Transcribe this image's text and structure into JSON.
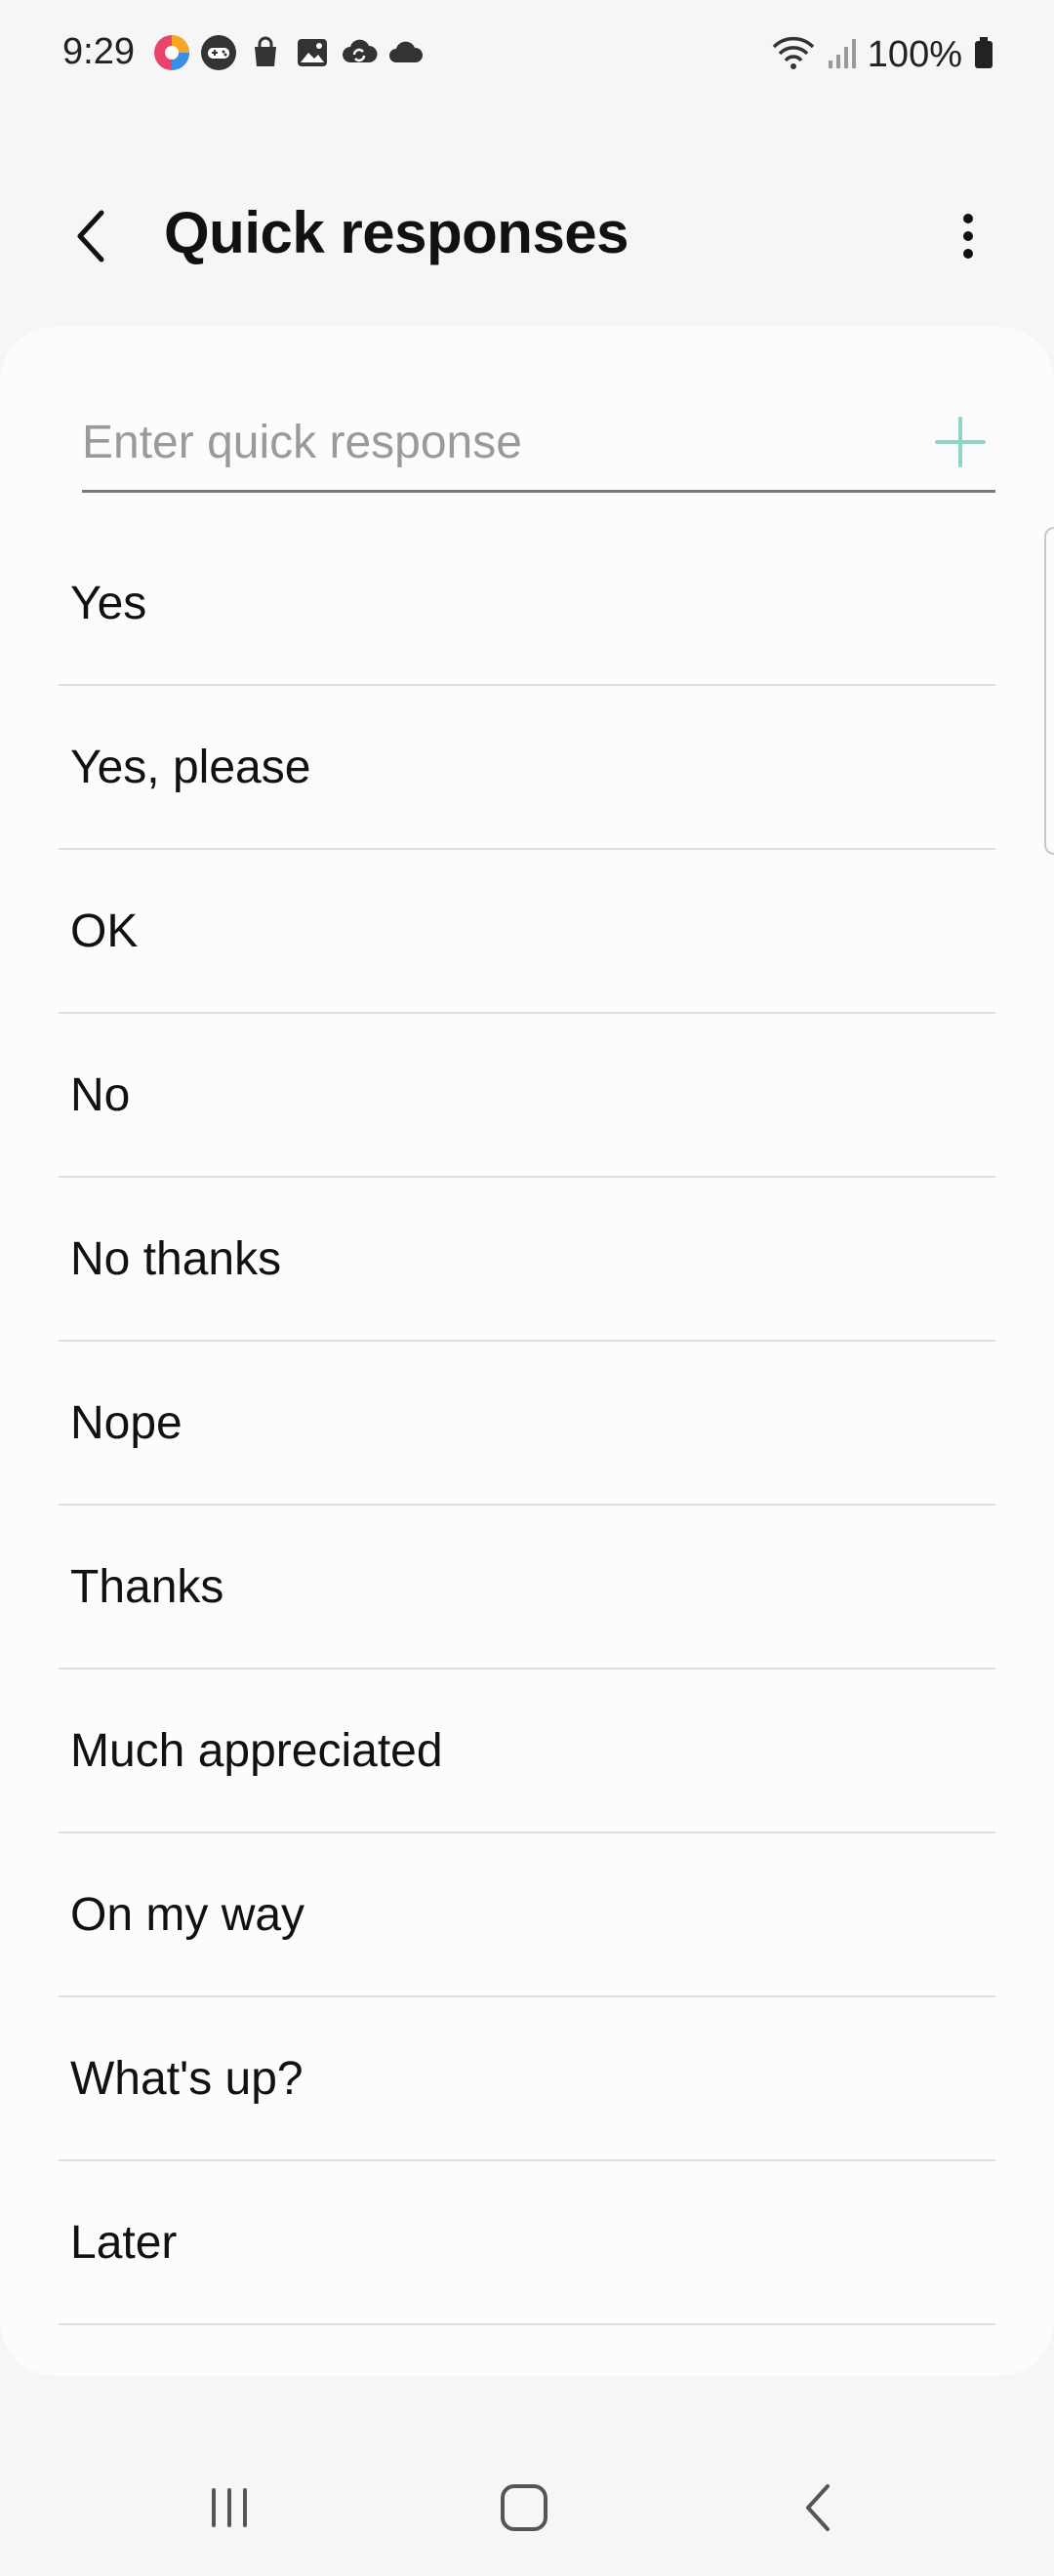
{
  "status_bar": {
    "time": "9:29",
    "notification_icons": [
      "colorful-app-icon",
      "game-controller-icon",
      "shopping-bag-icon",
      "gallery-icon",
      "cloud-sync-icon",
      "cloud-icon"
    ],
    "battery_text": "100%"
  },
  "app_bar": {
    "title": "Quick responses"
  },
  "input": {
    "placeholder": "Enter quick response",
    "value": ""
  },
  "responses": [
    "Yes",
    "Yes, please",
    "OK",
    "No",
    "No thanks",
    "Nope",
    "Thanks",
    "Much appreciated",
    "On my way",
    "What's up?",
    "Later"
  ],
  "colors": {
    "accent": "#8fd6c3",
    "background": "#f6f6f8",
    "card": "#fcfcfe"
  }
}
